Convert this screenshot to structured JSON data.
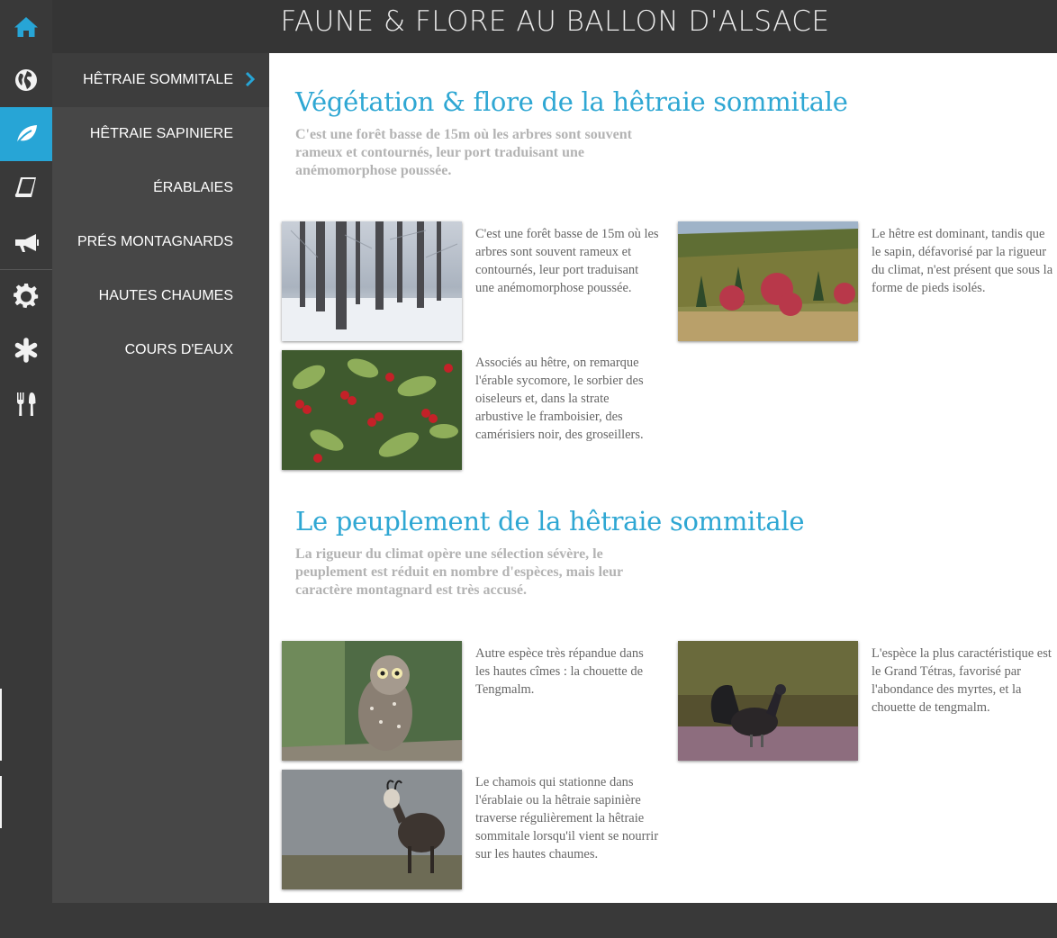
{
  "header": {
    "title": "FAUNE & FLORE AU BALLON D'ALSACE"
  },
  "iconbar": [
    {
      "icon": "home-icon"
    },
    {
      "icon": "globe-icon"
    },
    {
      "icon": "leaf-icon",
      "active": true
    },
    {
      "icon": "book-icon"
    },
    {
      "icon": "megaphone-icon"
    },
    {
      "icon": "gear-icon"
    },
    {
      "icon": "asterisk-icon"
    },
    {
      "icon": "cutlery-icon"
    }
  ],
  "submenu": {
    "items": [
      {
        "label": "HÊTRAIE SOMMITALE",
        "active": true
      },
      {
        "label": "HÊTRAIE SAPINIERE"
      },
      {
        "label": "ÉRABLAIES"
      },
      {
        "label": "PRÉS MONTAGNARDS"
      },
      {
        "label": "HAUTES CHAUMES"
      },
      {
        "label": "COURS D'EAUX"
      }
    ]
  },
  "sections": [
    {
      "title": "Végétation & flore de la hêtraie sommitale",
      "subtitle": "C'est une forêt basse de 15m où les arbres sont souvent rameux et contournés, leur port traduisant une anémomorphose poussée.",
      "cards": [
        {
          "image": "snowy-beech-forest-photo",
          "text": "C'est une forêt basse de 15m où les arbres sont souvent rameux et contournés, leur port traduisant une anémomorphose poussée."
        },
        {
          "image": "autumn-hillside-photo",
          "text": "Le hêtre est dominant, tandis que le sapin, défavorisé par la rigueur du climat, n'est présent que sous la forme de pieds isolés."
        },
        {
          "image": "red-berries-photo",
          "text": "Associés au hêtre, on remarque l'érable sycomore, le sorbier des oiseleurs et, dans la strate arbustive le framboisier, des camérisiers noir, des groseillers."
        }
      ]
    },
    {
      "title": "Le peuplement de la hêtraie sommitale",
      "subtitle": "La rigueur du climat opère une sélection sévère, le peuplement est réduit en nombre d'espèces, mais leur caractère montagnard est très accusé.",
      "cards": [
        {
          "image": "tengmalm-owl-photo",
          "text": "Autre espèce très répandue dans les hautes cîmes : la chouette de Tengmalm."
        },
        {
          "image": "grand-tetras-photo",
          "text": "L'espèce la plus caractéristique est le Grand Tétras, favorisé par l'abondance des myrtes, et la chouette de tengmalm."
        },
        {
          "image": "chamois-photo",
          "text": "Le chamois qui stationne dans l'érablaie ou la hêtraie sapinière traverse régulièrement la hêtraie sommitale lorsqu'il vient se nourrir sur les hautes chaumes."
        }
      ]
    }
  ],
  "colors": {
    "accent": "#27a5d6",
    "title": "#2fa7d3",
    "sidebar": "#393939",
    "submenu": "#474747",
    "subtitle": "#b3b3b3",
    "body_text": "#666666"
  }
}
